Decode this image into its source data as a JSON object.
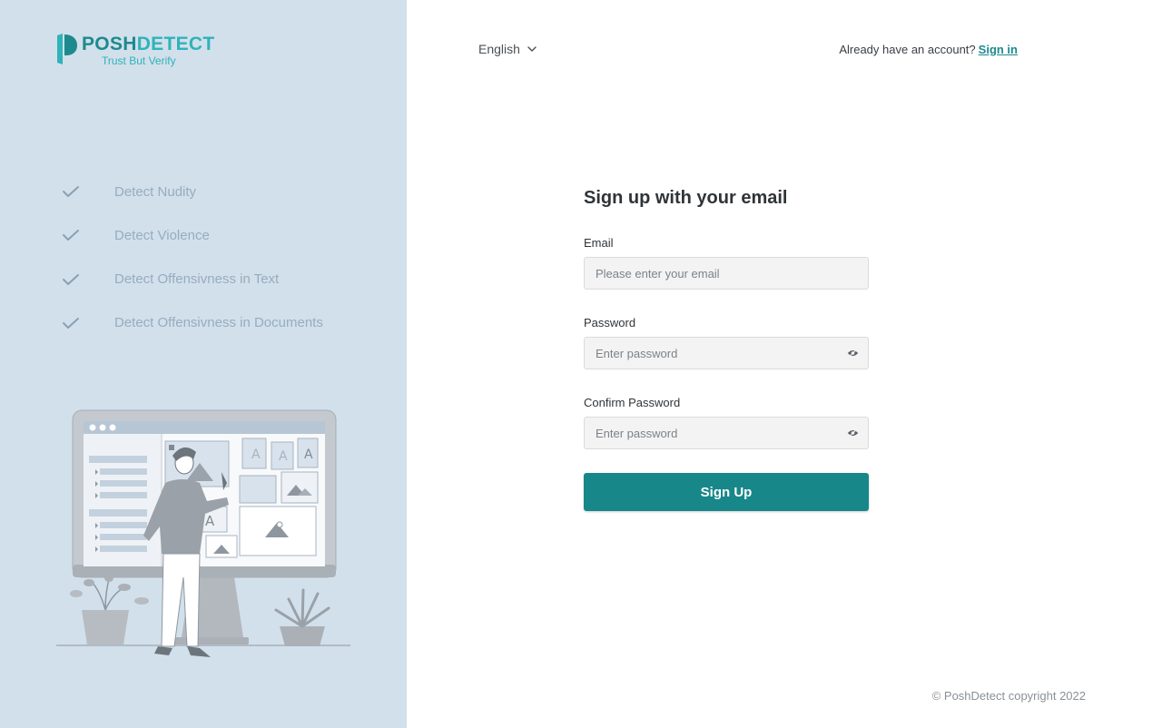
{
  "brand": {
    "name_part1": "POSH",
    "name_part2": "DETECT",
    "tagline": "Trust But Verify",
    "colors": {
      "dark": "#1d8a8e",
      "light": "#2fb3b8"
    }
  },
  "features": [
    {
      "label": "Detect Nudity",
      "icon": "check-icon"
    },
    {
      "label": "Detect Violence",
      "icon": "check-icon"
    },
    {
      "label": "Detect Offensivness in Text",
      "icon": "check-icon"
    },
    {
      "label": "Detect Offensivness in Documents",
      "icon": "check-icon"
    }
  ],
  "topbar": {
    "language": "English",
    "account_prompt": "Already have an account?",
    "signin_label": "Sign in"
  },
  "form": {
    "title": "Sign up with your email",
    "email_label": "Email",
    "email_placeholder": "Please enter your email",
    "email_value": "",
    "password_label": "Password",
    "password_placeholder": "Enter password",
    "password_value": "",
    "confirm_label": "Confirm Password",
    "confirm_placeholder": "Enter password",
    "confirm_value": "",
    "submit_label": "Sign Up"
  },
  "footer": {
    "copyright": "© PoshDetect copyright 2022"
  },
  "colors": {
    "accent": "#17878a",
    "panel": "#d2e0eb",
    "feature_text": "#97acbf"
  }
}
